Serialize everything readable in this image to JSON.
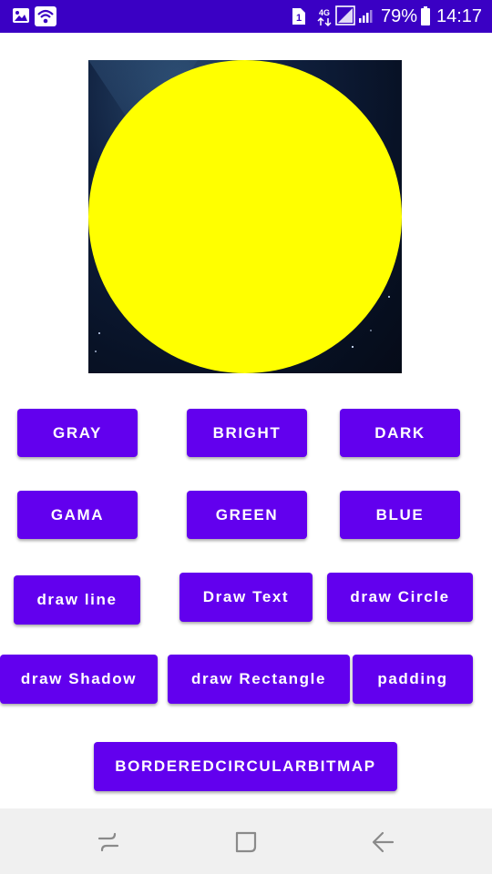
{
  "status_bar": {
    "sim_slot": "1",
    "network": "4G",
    "battery_percent": "79%",
    "time": "14:17",
    "icons": [
      "gallery-icon",
      "wifi-icon",
      "sim-icon",
      "network-4g-icon",
      "signal-icon",
      "battery-icon"
    ]
  },
  "image_view": {
    "circle_color": "#ffff00",
    "background": "space-starfield"
  },
  "buttons": {
    "gray": "GRAY",
    "bright": "BRIGHT",
    "dark": "DARK",
    "gama": "GAMA",
    "green": "GREEN",
    "blue": "BLUE",
    "draw_line": "draw line",
    "draw_text": "Draw Text",
    "draw_circle": "draw Circle",
    "draw_shadow": "draw Shadow",
    "draw_rectangle": "draw Rectangle",
    "padding": "padding",
    "bordered_circular_bitmap": "BORDEREDCIRCULARBITMAP"
  },
  "colors": {
    "status_bar": "#3a00c4",
    "button": "#6200ee",
    "button_text": "#ffffff",
    "nav_bar": "#f0f0f0"
  },
  "nav_bar": {
    "icons": [
      "recents-icon",
      "home-icon",
      "back-icon"
    ]
  }
}
